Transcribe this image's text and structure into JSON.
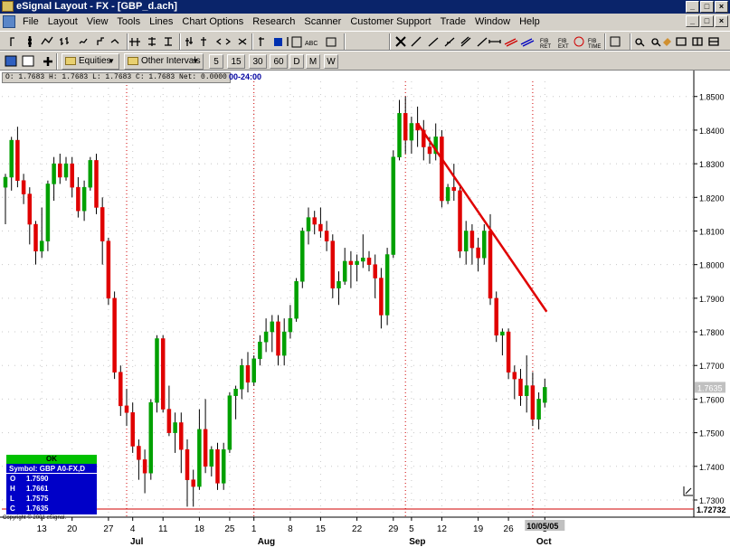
{
  "window": {
    "title": "eSignal Layout - FX - [GBP_d.ach]",
    "buttons": [
      "_",
      "□",
      "×"
    ]
  },
  "menu": {
    "items": [
      "File",
      "Layout",
      "View",
      "Tools",
      "Lines",
      "Chart Options",
      "Research",
      "Scanner",
      "Customer Support",
      "Trade",
      "Window",
      "Help"
    ],
    "mdi_buttons": [
      "_",
      "□",
      "×"
    ]
  },
  "toolbar2": {
    "equities_label": "Equities",
    "intervals_label": "Other Intervals",
    "intervals": [
      "5",
      "15",
      "30",
      "60",
      "D",
      "M",
      "W"
    ]
  },
  "chart": {
    "ohlc_text": "O:  1.7683    H:  1.7683    L:  1.7683    C:  1.7683    Net:  0.0000",
    "time_label": "00-24:00",
    "last_price": "1.7635",
    "low_marker": "1.72732",
    "date_marker": "10/05/05",
    "copyright": "Copyright © 2001 eSignal.",
    "info": {
      "status": "OK",
      "symbol": "Symbol: GBP A0-FX,D",
      "rows": [
        {
          "k": "O",
          "v": "1.7590"
        },
        {
          "k": "H",
          "v": "1.7661"
        },
        {
          "k": "L",
          "v": "1.7575"
        },
        {
          "k": "C",
          "v": "1.7635"
        }
      ]
    },
    "colors": {
      "up": "#00a000",
      "down": "#e00000",
      "trendline": "#e00000",
      "background": "#ffffff",
      "grid": "#c8c8c8",
      "separator": "#d00000"
    }
  },
  "chart_data": {
    "type": "candlestick",
    "y_ticks": [
      "1.8500",
      "1.8400",
      "1.8300",
      "1.8200",
      "1.8100",
      "1.8000",
      "1.7900",
      "1.7800",
      "1.7700",
      "1.7600",
      "1.7500",
      "1.7400",
      "1.7300"
    ],
    "ylim": [
      1.7265,
      1.8545
    ],
    "x_day_ticks": [
      "13",
      "20",
      "27",
      "4",
      "11",
      "18",
      "25",
      "1",
      "8",
      "15",
      "22",
      "29",
      "5",
      "12",
      "19",
      "26",
      "3"
    ],
    "x_month_labels": [
      "Jul",
      "Aug",
      "Sep",
      "Oct"
    ],
    "candles": [
      {
        "o": 1.823,
        "h": 1.827,
        "l": 1.812,
        "c": 1.826
      },
      {
        "o": 1.826,
        "h": 1.838,
        "l": 1.822,
        "c": 1.837
      },
      {
        "o": 1.837,
        "h": 1.841,
        "l": 1.823,
        "c": 1.825
      },
      {
        "o": 1.825,
        "h": 1.827,
        "l": 1.818,
        "c": 1.821
      },
      {
        "o": 1.821,
        "h": 1.823,
        "l": 1.806,
        "c": 1.812
      },
      {
        "o": 1.812,
        "h": 1.813,
        "l": 1.8,
        "c": 1.804
      },
      {
        "o": 1.804,
        "h": 1.817,
        "l": 1.802,
        "c": 1.807
      },
      {
        "o": 1.807,
        "h": 1.825,
        "l": 1.804,
        "c": 1.824
      },
      {
        "o": 1.824,
        "h": 1.832,
        "l": 1.819,
        "c": 1.83
      },
      {
        "o": 1.83,
        "h": 1.833,
        "l": 1.824,
        "c": 1.826
      },
      {
        "o": 1.826,
        "h": 1.832,
        "l": 1.825,
        "c": 1.83
      },
      {
        "o": 1.83,
        "h": 1.832,
        "l": 1.82,
        "c": 1.823
      },
      {
        "o": 1.823,
        "h": 1.826,
        "l": 1.814,
        "c": 1.816
      },
      {
        "o": 1.816,
        "h": 1.825,
        "l": 1.813,
        "c": 1.823
      },
      {
        "o": 1.823,
        "h": 1.832,
        "l": 1.822,
        "c": 1.831
      },
      {
        "o": 1.831,
        "h": 1.833,
        "l": 1.815,
        "c": 1.817
      },
      {
        "o": 1.817,
        "h": 1.82,
        "l": 1.8,
        "c": 1.807
      },
      {
        "o": 1.807,
        "h": 1.808,
        "l": 1.788,
        "c": 1.79
      },
      {
        "o": 1.79,
        "h": 1.792,
        "l": 1.766,
        "c": 1.768
      },
      {
        "o": 1.768,
        "h": 1.77,
        "l": 1.755,
        "c": 1.758
      },
      {
        "o": 1.758,
        "h": 1.763,
        "l": 1.752,
        "c": 1.756
      },
      {
        "o": 1.756,
        "h": 1.759,
        "l": 1.744,
        "c": 1.746
      },
      {
        "o": 1.746,
        "h": 1.748,
        "l": 1.736,
        "c": 1.742
      },
      {
        "o": 1.742,
        "h": 1.745,
        "l": 1.732,
        "c": 1.738
      },
      {
        "o": 1.738,
        "h": 1.76,
        "l": 1.736,
        "c": 1.759
      },
      {
        "o": 1.759,
        "h": 1.779,
        "l": 1.756,
        "c": 1.778
      },
      {
        "o": 1.778,
        "h": 1.779,
        "l": 1.756,
        "c": 1.757
      },
      {
        "o": 1.757,
        "h": 1.764,
        "l": 1.749,
        "c": 1.75
      },
      {
        "o": 1.75,
        "h": 1.756,
        "l": 1.744,
        "c": 1.753
      },
      {
        "o": 1.753,
        "h": 1.756,
        "l": 1.738,
        "c": 1.745
      },
      {
        "o": 1.745,
        "h": 1.748,
        "l": 1.728,
        "c": 1.736
      },
      {
        "o": 1.736,
        "h": 1.739,
        "l": 1.728,
        "c": 1.734
      },
      {
        "o": 1.734,
        "h": 1.757,
        "l": 1.733,
        "c": 1.751
      },
      {
        "o": 1.751,
        "h": 1.76,
        "l": 1.738,
        "c": 1.74
      },
      {
        "o": 1.74,
        "h": 1.746,
        "l": 1.737,
        "c": 1.745
      },
      {
        "o": 1.745,
        "h": 1.747,
        "l": 1.733,
        "c": 1.735
      },
      {
        "o": 1.735,
        "h": 1.747,
        "l": 1.733,
        "c": 1.745
      },
      {
        "o": 1.745,
        "h": 1.762,
        "l": 1.744,
        "c": 1.761
      },
      {
        "o": 1.761,
        "h": 1.764,
        "l": 1.754,
        "c": 1.763
      },
      {
        "o": 1.763,
        "h": 1.772,
        "l": 1.76,
        "c": 1.77
      },
      {
        "o": 1.77,
        "h": 1.774,
        "l": 1.762,
        "c": 1.765
      },
      {
        "o": 1.765,
        "h": 1.773,
        "l": 1.764,
        "c": 1.772
      },
      {
        "o": 1.772,
        "h": 1.779,
        "l": 1.77,
        "c": 1.777
      },
      {
        "o": 1.777,
        "h": 1.784,
        "l": 1.774,
        "c": 1.78
      },
      {
        "o": 1.78,
        "h": 1.785,
        "l": 1.774,
        "c": 1.783
      },
      {
        "o": 1.783,
        "h": 1.785,
        "l": 1.77,
        "c": 1.773
      },
      {
        "o": 1.773,
        "h": 1.784,
        "l": 1.77,
        "c": 1.78
      },
      {
        "o": 1.78,
        "h": 1.788,
        "l": 1.778,
        "c": 1.784
      },
      {
        "o": 1.784,
        "h": 1.796,
        "l": 1.783,
        "c": 1.795
      },
      {
        "o": 1.795,
        "h": 1.811,
        "l": 1.793,
        "c": 1.81
      },
      {
        "o": 1.81,
        "h": 1.817,
        "l": 1.806,
        "c": 1.814
      },
      {
        "o": 1.814,
        "h": 1.816,
        "l": 1.809,
        "c": 1.812
      },
      {
        "o": 1.812,
        "h": 1.817,
        "l": 1.808,
        "c": 1.81
      },
      {
        "o": 1.81,
        "h": 1.813,
        "l": 1.804,
        "c": 1.807
      },
      {
        "o": 1.807,
        "h": 1.809,
        "l": 1.79,
        "c": 1.793
      },
      {
        "o": 1.793,
        "h": 1.798,
        "l": 1.788,
        "c": 1.795
      },
      {
        "o": 1.795,
        "h": 1.805,
        "l": 1.794,
        "c": 1.801
      },
      {
        "o": 1.801,
        "h": 1.804,
        "l": 1.793,
        "c": 1.8
      },
      {
        "o": 1.8,
        "h": 1.803,
        "l": 1.795,
        "c": 1.801
      },
      {
        "o": 1.801,
        "h": 1.809,
        "l": 1.799,
        "c": 1.802
      },
      {
        "o": 1.802,
        "h": 1.804,
        "l": 1.798,
        "c": 1.8
      },
      {
        "o": 1.8,
        "h": 1.803,
        "l": 1.79,
        "c": 1.796
      },
      {
        "o": 1.796,
        "h": 1.799,
        "l": 1.781,
        "c": 1.785
      },
      {
        "o": 1.785,
        "h": 1.805,
        "l": 1.782,
        "c": 1.803
      },
      {
        "o": 1.803,
        "h": 1.834,
        "l": 1.802,
        "c": 1.832
      },
      {
        "o": 1.832,
        "h": 1.849,
        "l": 1.831,
        "c": 1.845
      },
      {
        "o": 1.845,
        "h": 1.85,
        "l": 1.833,
        "c": 1.837
      },
      {
        "o": 1.837,
        "h": 1.844,
        "l": 1.833,
        "c": 1.842
      },
      {
        "o": 1.842,
        "h": 1.847,
        "l": 1.835,
        "c": 1.84
      },
      {
        "o": 1.84,
        "h": 1.843,
        "l": 1.831,
        "c": 1.835
      },
      {
        "o": 1.835,
        "h": 1.838,
        "l": 1.83,
        "c": 1.833
      },
      {
        "o": 1.833,
        "h": 1.842,
        "l": 1.831,
        "c": 1.838
      },
      {
        "o": 1.838,
        "h": 1.84,
        "l": 1.817,
        "c": 1.819
      },
      {
        "o": 1.819,
        "h": 1.824,
        "l": 1.818,
        "c": 1.823
      },
      {
        "o": 1.823,
        "h": 1.83,
        "l": 1.819,
        "c": 1.822
      },
      {
        "o": 1.822,
        "h": 1.824,
        "l": 1.802,
        "c": 1.804
      },
      {
        "o": 1.804,
        "h": 1.813,
        "l": 1.8,
        "c": 1.81
      },
      {
        "o": 1.81,
        "h": 1.812,
        "l": 1.8,
        "c": 1.805
      },
      {
        "o": 1.805,
        "h": 1.808,
        "l": 1.798,
        "c": 1.802
      },
      {
        "o": 1.802,
        "h": 1.812,
        "l": 1.8,
        "c": 1.81
      },
      {
        "o": 1.81,
        "h": 1.815,
        "l": 1.788,
        "c": 1.79
      },
      {
        "o": 1.79,
        "h": 1.792,
        "l": 1.777,
        "c": 1.779
      },
      {
        "o": 1.779,
        "h": 1.781,
        "l": 1.773,
        "c": 1.78
      },
      {
        "o": 1.78,
        "h": 1.781,
        "l": 1.766,
        "c": 1.768
      },
      {
        "o": 1.768,
        "h": 1.77,
        "l": 1.76,
        "c": 1.766
      },
      {
        "o": 1.766,
        "h": 1.769,
        "l": 1.758,
        "c": 1.761
      },
      {
        "o": 1.761,
        "h": 1.773,
        "l": 1.756,
        "c": 1.764
      },
      {
        "o": 1.764,
        "h": 1.768,
        "l": 1.752,
        "c": 1.754
      },
      {
        "o": 1.754,
        "h": 1.762,
        "l": 1.751,
        "c": 1.76
      },
      {
        "o": 1.759,
        "h": 1.7661,
        "l": 1.7575,
        "c": 1.7635
      }
    ]
  }
}
